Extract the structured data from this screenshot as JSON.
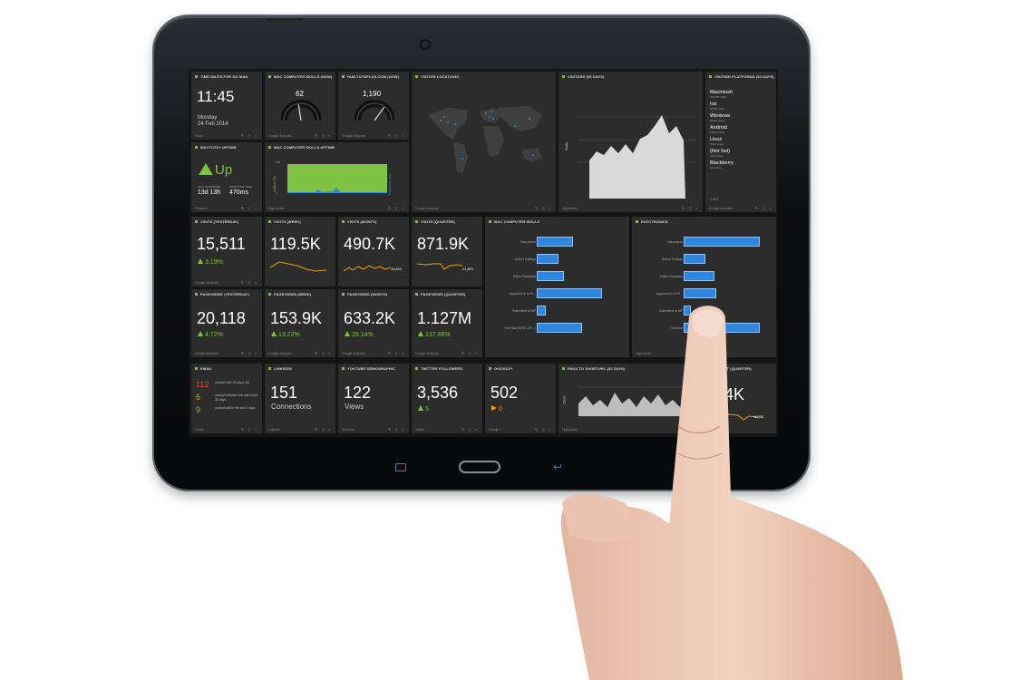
{
  "tiles": {
    "clock": {
      "title": "TIME WAITS FOR NO MAN",
      "time": "11:45",
      "day": "Monday",
      "date": "24 Feb 2014",
      "foot": "Clock"
    },
    "gauge1": {
      "title": "MAC COMPUTER SKILLS (NOW)",
      "value": "62",
      "foot": "Google Analytics",
      "level": 0.45
    },
    "gauge2": {
      "title": "HUB.TUTSPLUS.COM (NOW)",
      "value": "1,190",
      "foot": "Google Analytics",
      "level": 0.7
    },
    "visitor_locations": {
      "title": "VISITOR LOCATIONS",
      "foot": "Google Analytics"
    },
    "visitors30": {
      "title": "VISITORS (30 DAYS)",
      "foot": "Highcharts",
      "ylabel": "Visits"
    },
    "platforms": {
      "title": "VISITING PLATFORMS (30 DAYS)",
      "foot": "Google Analytics",
      "page": "1 of 3",
      "items": [
        {
          "name": "Macintosh",
          "visits": "364798 Visits"
        },
        {
          "name": "Ios",
          "visits": "66504 Visits"
        },
        {
          "name": "Windows",
          "visits": "55034 Visits"
        },
        {
          "name": "Android",
          "visits": "10891 Visits"
        },
        {
          "name": "Linux",
          "visits": "4060 Visits"
        },
        {
          "name": "(Not Set)",
          "visits": "3104 Visits"
        },
        {
          "name": "Blackberry",
          "visits": "412 Visits"
        }
      ]
    },
    "uptime1": {
      "title": "MACTUTS+ UPTIME",
      "status": "Up",
      "l1": "LAST DOWNTIME",
      "v1": "13d 13h",
      "l2": "RESPONSE TIME",
      "v2": "470ms",
      "foot": "Pingdom"
    },
    "uptime2": {
      "title": "MAC COMPUTER SKILLS UPTIME",
      "foot": "Highcharts",
      "yl": "Uptime (%)",
      "yr": "Response (ms)",
      "y100": "100",
      "y0": "0"
    },
    "visits_y": {
      "title": "VISITS (YESTERDAY)",
      "value": "15,511",
      "delta": "3.19%",
      "foot": "Google Analytics"
    },
    "visits_w": {
      "title": "VISITS (WEEK)",
      "value": "119.5K"
    },
    "visits_m": {
      "title": "VISITS (MONTH)",
      "value": "490.7K",
      "spark": "15,511"
    },
    "visits_q": {
      "title": "VISITS (QUARTER)",
      "value": "871.9K",
      "spark": "21,801"
    },
    "skills_bar": {
      "title": "MAC COMPUTER SKILLS",
      "labels": [
        "Discussion",
        "Author Ratings",
        "Editor Requests",
        "Approved & In Pr...",
        "Submitted to MP",
        "Overdue (DATE ON...)"
      ]
    },
    "electronics": {
      "title": "ELECTRONICS",
      "foot": "Highcharts",
      "labels": [
        "Discussion",
        "Author Ratings",
        "Editor Requests",
        "Approved & In Pr...",
        "Submitted to MP",
        "Overdue"
      ]
    },
    "pv_y": {
      "title": "PAGEVIEWS (YESTERDAY)",
      "value": "20,118",
      "delta": "4.72%",
      "foot": "Google Analytics"
    },
    "pv_w": {
      "title": "PAGEVIEWS (WEEK)",
      "value": "153.9K",
      "delta": "13.22%",
      "foot": "Google Analytics"
    },
    "pv_m": {
      "title": "PAGEVIEWS (MONTH)",
      "value": "633.2K",
      "delta": "28.14%",
      "foot": "Google Analytics"
    },
    "pv_q": {
      "title": "PAGEVIEWS (QUARTER)",
      "value": "1.127M",
      "delta": "137.86%",
      "foot": "Google Analytics"
    },
    "email": {
      "title": "EMAIL",
      "foot": "Gmail",
      "rows": [
        {
          "n": "112",
          "t": "unread over 30 days old"
        },
        {
          "n": "6",
          "t": "unread between the last 3 and 30 days"
        },
        {
          "n": "9",
          "t": "unread within the last 3 days"
        }
      ]
    },
    "linkedin": {
      "title": "LINKEDIN",
      "value": "151",
      "label": "Connections",
      "foot": "LinkedIn"
    },
    "youtube": {
      "title": "YOUTUBE DEMOGRAPHIC",
      "value": "122",
      "label": "Views",
      "foot": "YouTube"
    },
    "twitter": {
      "title": "TWITTER FOLLOWERS",
      "value": "3,536",
      "delta": "5",
      "foot": "Twitter"
    },
    "google": {
      "title": "GOOGLE+",
      "value": "502",
      "delta": "0",
      "foot": "Google+"
    },
    "envato": {
      "title": "ENVA.TO SHORTURL (30 DAYS)",
      "foot": "Highcharts",
      "ylabel": "Clicks"
    },
    "tablet_tile": {
      "title": "TABLET (QUARTER)",
      "value": "4.4K",
      "spark": "8,598"
    }
  },
  "colors": {
    "accent_green": "#7fc241",
    "bar_blue": "#2e86de",
    "email_red": "#e0523a",
    "email_orange": "#f0a000",
    "email_green": "#7fc241"
  }
}
